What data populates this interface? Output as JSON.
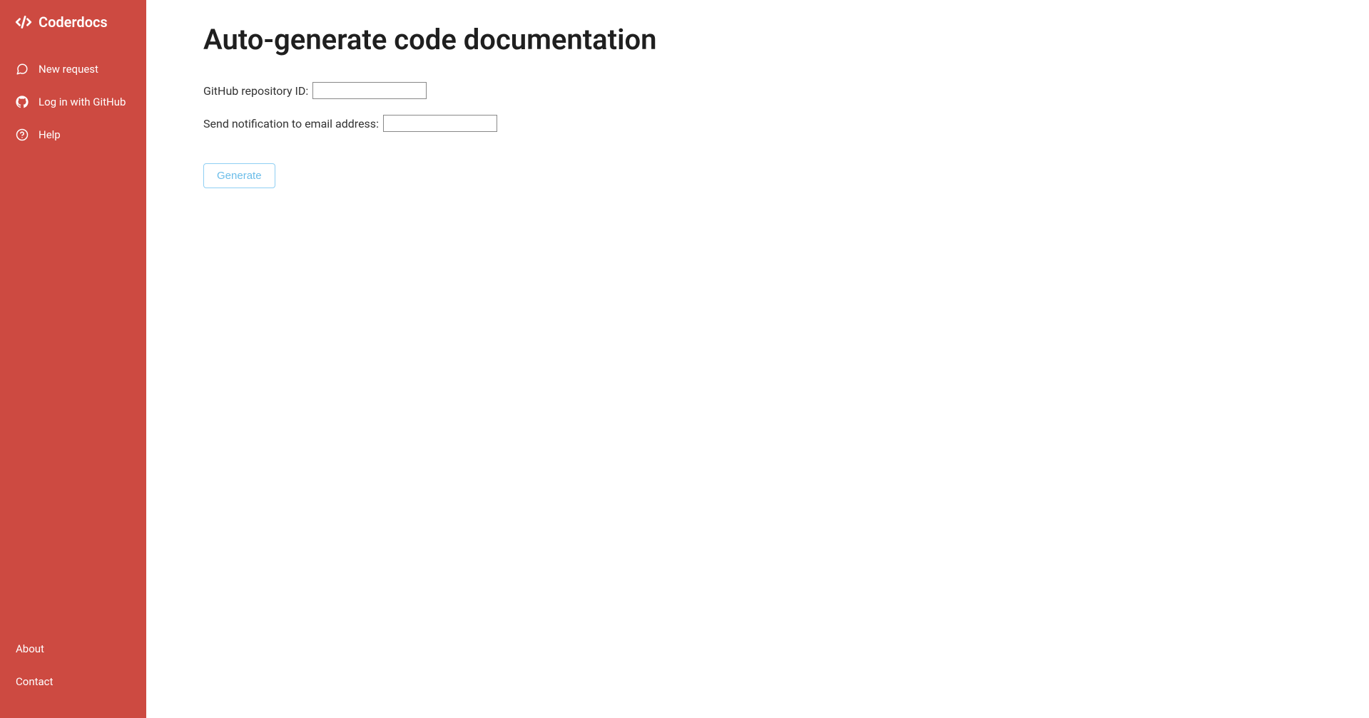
{
  "sidebar": {
    "brand": "Coderdocs",
    "items": [
      {
        "label": "New request",
        "icon": "comment-icon"
      },
      {
        "label": "Log in with GitHub",
        "icon": "github-icon"
      },
      {
        "label": "Help",
        "icon": "help-icon"
      }
    ],
    "footer": [
      {
        "label": "About"
      },
      {
        "label": "Contact"
      }
    ]
  },
  "main": {
    "title": "Auto-generate code documentation",
    "form": {
      "repo_label": "GitHub repository ID:",
      "repo_value": "",
      "email_label": "Send notification to email address:",
      "email_value": "",
      "generate_label": "Generate"
    }
  },
  "colors": {
    "sidebar_bg": "#cd4a41",
    "button_border": "#8fcff3",
    "button_text": "#6bbde9"
  }
}
